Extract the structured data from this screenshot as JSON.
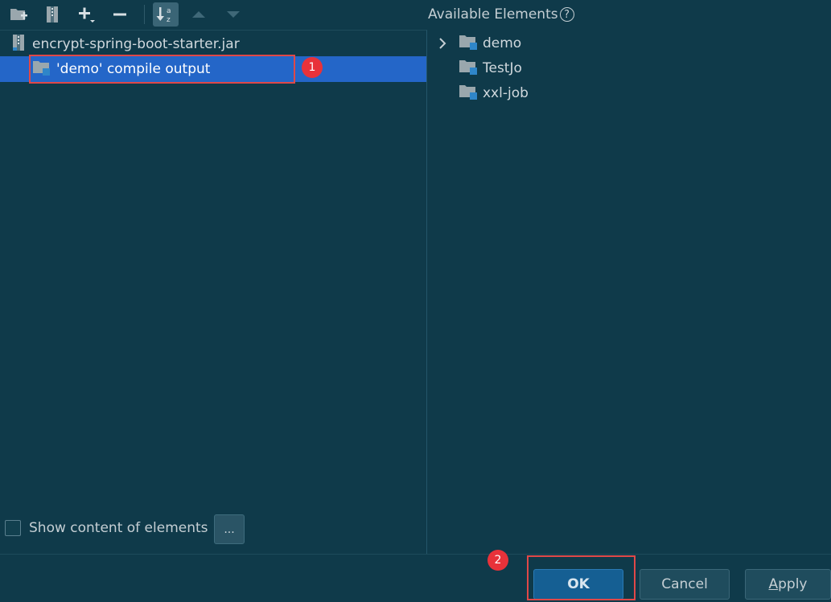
{
  "toolbar": {
    "icons": [
      "new-folder-icon",
      "archive-icon",
      "add-icon",
      "remove-icon",
      "sort-alpha-icon",
      "move-up-icon",
      "move-down-icon"
    ]
  },
  "layout_tree": {
    "root": {
      "label": "encrypt-spring-boot-starter.jar",
      "icon": "jar-icon"
    },
    "child": {
      "label": "'demo' compile output",
      "icon": "module-folder-icon",
      "selected": true
    }
  },
  "callouts": {
    "one": "1",
    "two": "2"
  },
  "available": {
    "title": "Available Elements",
    "help": "?",
    "items": [
      {
        "label": "demo",
        "expandable": true
      },
      {
        "label": "TestJo",
        "expandable": false
      },
      {
        "label": "xxl-job",
        "expandable": false
      }
    ]
  },
  "options": {
    "show_content_label": "Show content of elements",
    "show_content_checked": false,
    "dots_label": "..."
  },
  "buttons": {
    "ok": "OK",
    "cancel": "Cancel",
    "apply_u": "A",
    "apply_rest": "pply"
  },
  "colors": {
    "background": "#0f3a4a",
    "selection": "#2466c8",
    "callout": "#e04848",
    "ok_button": "#155f93"
  }
}
